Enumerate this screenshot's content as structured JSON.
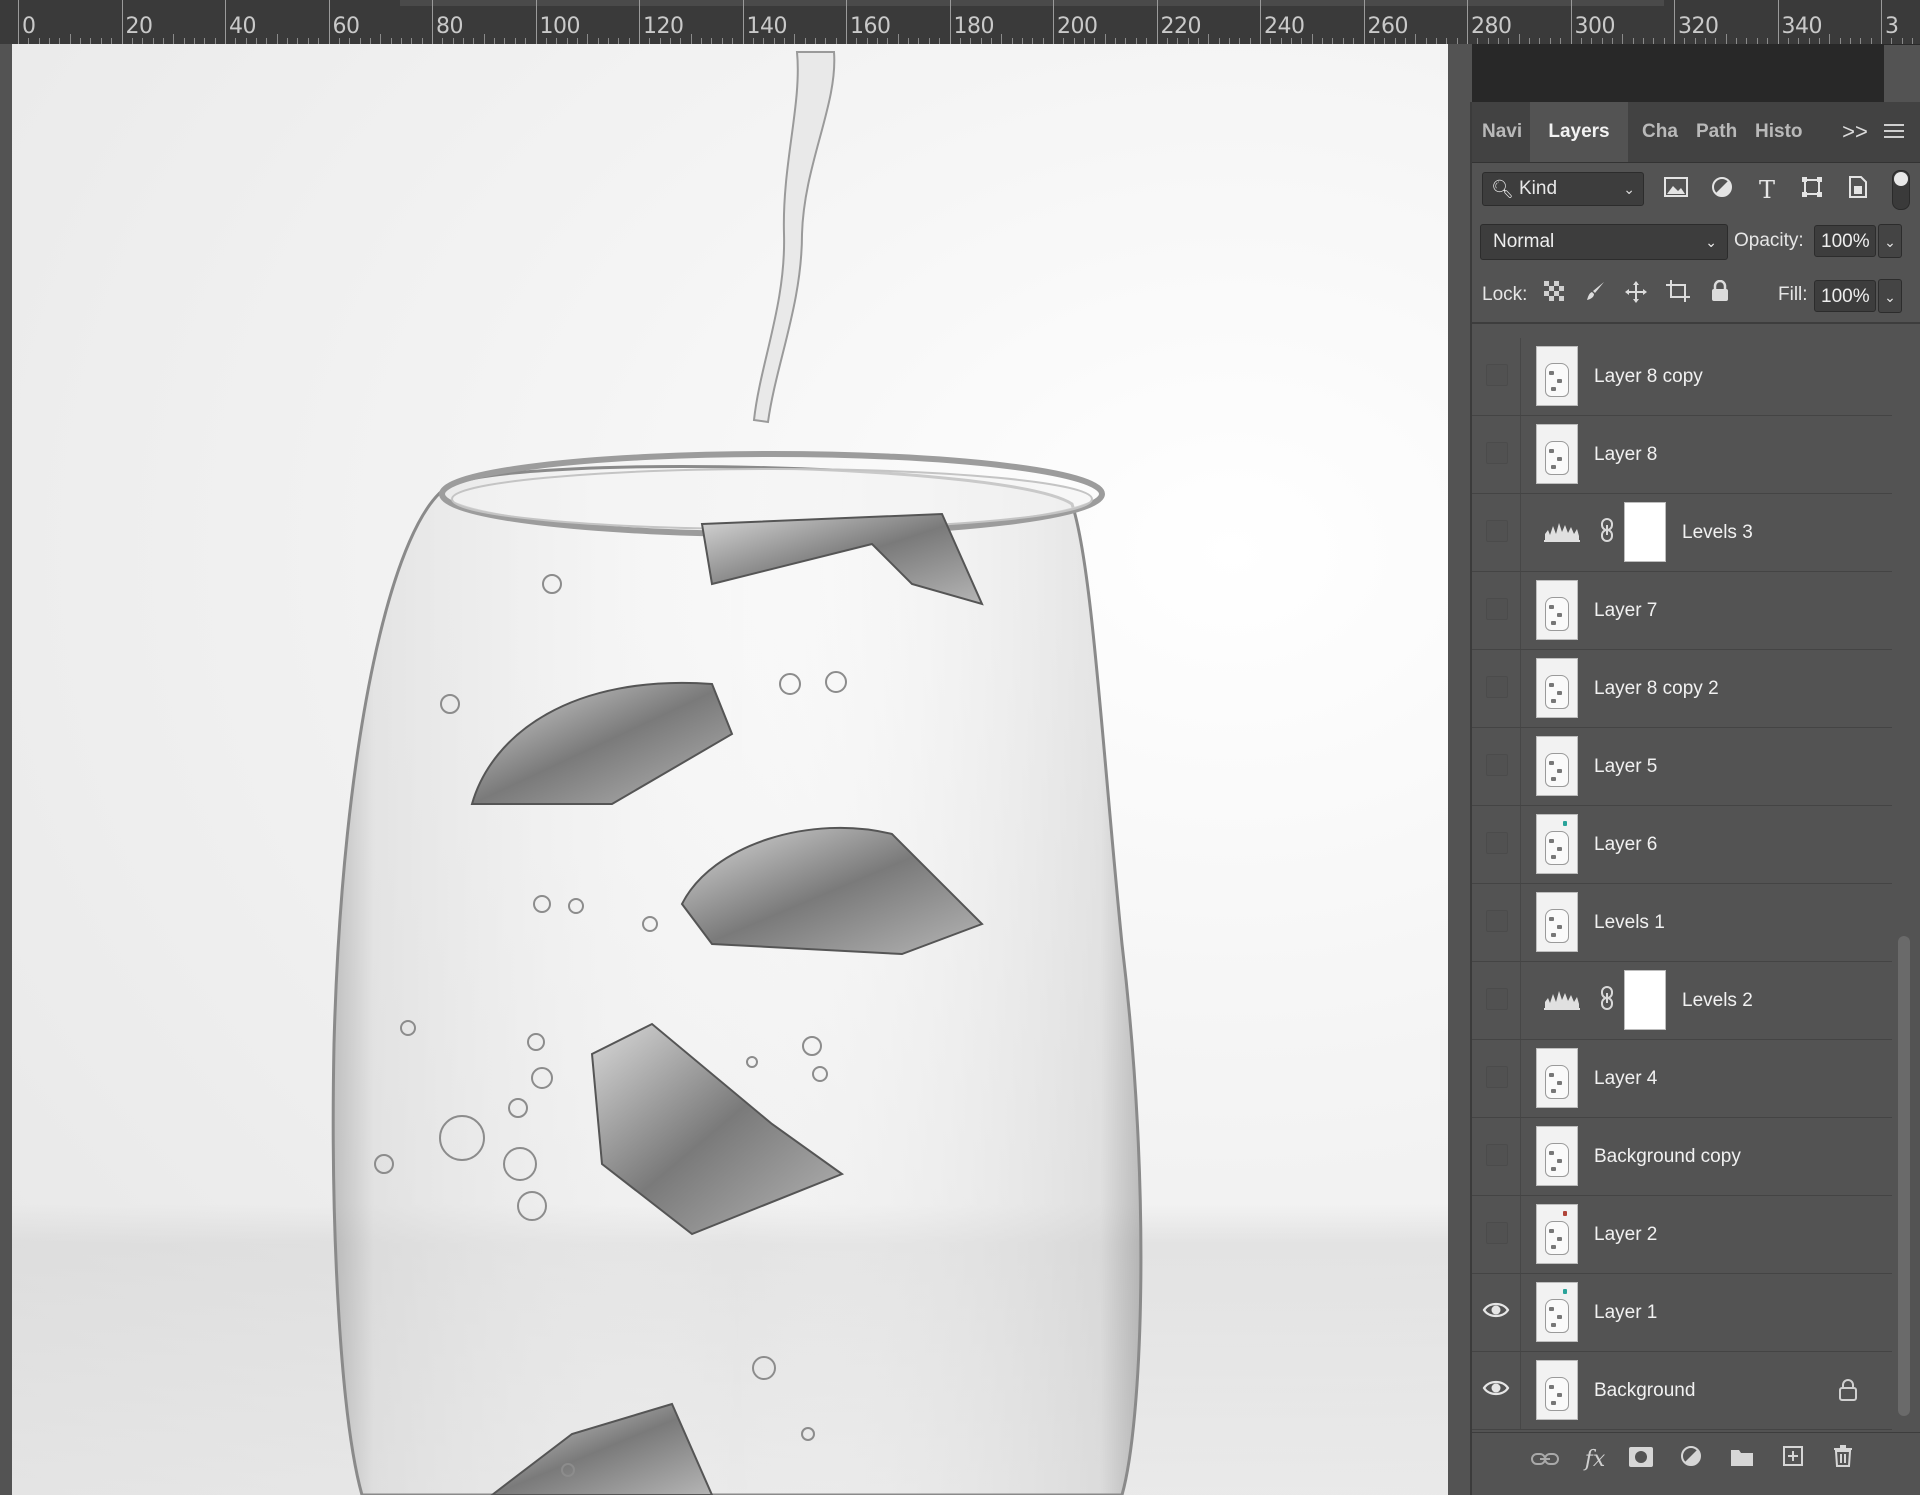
{
  "ruler": {
    "labels": [
      "0",
      "20",
      "40",
      "60",
      "80",
      "100",
      "120",
      "140",
      "160",
      "180",
      "200",
      "220",
      "240",
      "260",
      "280",
      "300",
      "320",
      "340",
      "3"
    ]
  },
  "panel": {
    "tabs": [
      {
        "label": "Navi",
        "active": false
      },
      {
        "label": "Layers",
        "active": true
      },
      {
        "label": "Cha",
        "active": false
      },
      {
        "label": "Path",
        "active": false
      },
      {
        "label": "Histo",
        "active": false
      }
    ],
    "more_label": ">>",
    "filter": {
      "kind_label": "Kind"
    },
    "blend": {
      "mode": "Normal",
      "opacity_label": "Opacity:",
      "opacity_value": "100%"
    },
    "lock": {
      "label": "Lock:",
      "fill_label": "Fill:",
      "fill_value": "100%"
    },
    "layers": [
      {
        "name": "Layer 8 copy",
        "type": "pixel",
        "visible": false
      },
      {
        "name": "Layer 8",
        "type": "pixel",
        "visible": false
      },
      {
        "name": "Levels 3",
        "type": "adjustment",
        "visible": false
      },
      {
        "name": "Layer 7",
        "type": "pixel",
        "visible": false
      },
      {
        "name": "Layer 8 copy 2",
        "type": "pixel",
        "visible": false
      },
      {
        "name": "Layer 5",
        "type": "pixel",
        "visible": false
      },
      {
        "name": "Layer 6",
        "type": "pixel",
        "visible": false,
        "tint": "#2aa39a"
      },
      {
        "name": "Levels 1",
        "type": "pixel",
        "visible": false
      },
      {
        "name": "Levels 2",
        "type": "adjustment",
        "visible": false
      },
      {
        "name": "Layer 4",
        "type": "pixel",
        "visible": false
      },
      {
        "name": "Background copy",
        "type": "pixel",
        "visible": false
      },
      {
        "name": "Layer 2",
        "type": "pixel",
        "visible": false,
        "tint": "#b0453a"
      },
      {
        "name": "Layer 1",
        "type": "pixel",
        "visible": true,
        "tint": "#2aa39a"
      },
      {
        "name": "Background",
        "type": "pixel",
        "visible": true,
        "locked": true
      }
    ]
  },
  "colors": {
    "panel_bg": "#535353",
    "tabbar_bg": "#424242",
    "text": "#f1f1f1",
    "canvas_bg": "#f4f4f4"
  }
}
